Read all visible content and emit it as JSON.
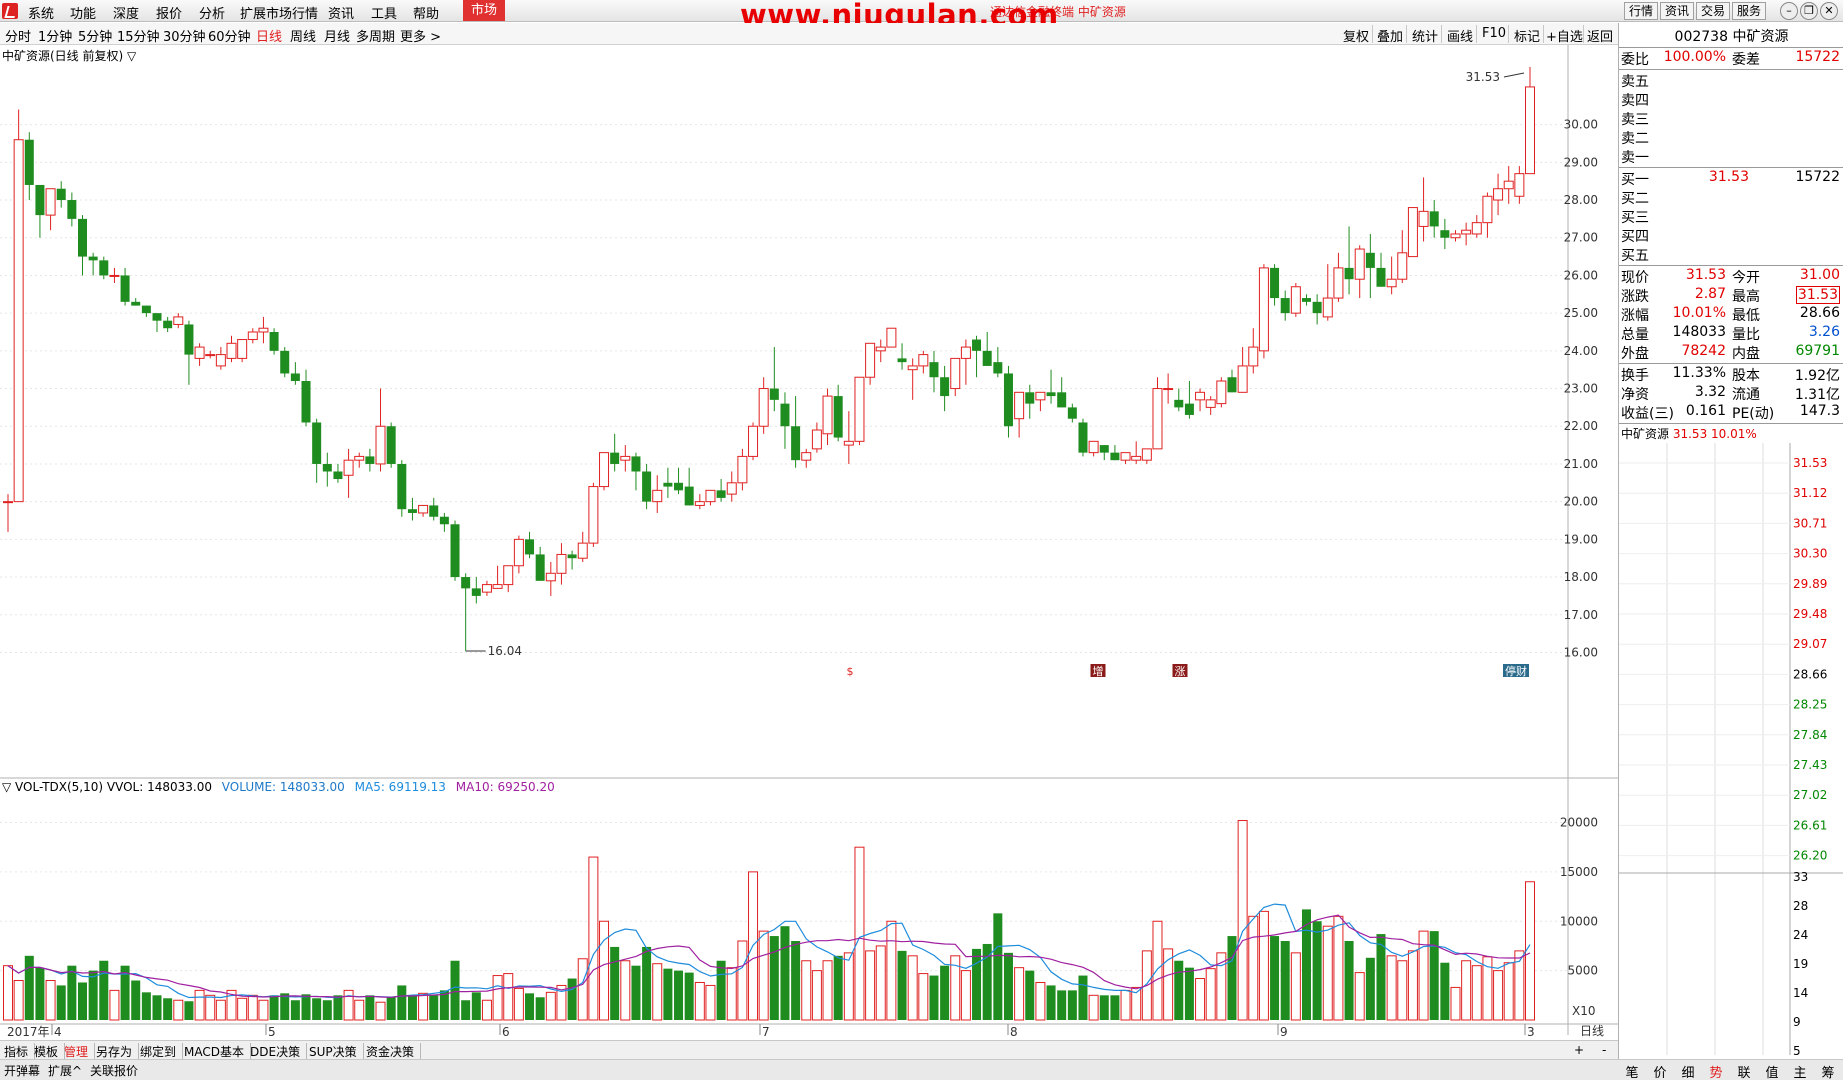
{
  "menu": {
    "items": [
      "系统",
      "功能",
      "深度",
      "报价",
      "分析",
      "扩展市场行情",
      "资讯",
      "工具",
      "帮助"
    ],
    "market": "市场",
    "banner": "通达信金融终端 中矿资源",
    "watermark": "www.niugulan.com",
    "right_buttons": [
      "行情",
      "资讯",
      "交易",
      "服务"
    ],
    "window_controls": [
      "minimize-icon",
      "restore-icon",
      "close-icon"
    ]
  },
  "periods": [
    "分时",
    "1分钟",
    "5分钟",
    "15分钟",
    "30分钟",
    "60分钟",
    "日线",
    "周线",
    "月线",
    "多周期",
    "更多 >"
  ],
  "active_period": "日线",
  "tools": [
    "复权",
    "叠加",
    "统计",
    "画线",
    "F10",
    "标记",
    "+自选",
    "返回"
  ],
  "kline": {
    "title": "中矿资源(日线 前复权) ▽",
    "max_label": "31.53",
    "min_label": "16.04",
    "price_ticks": [
      "30.00",
      "29.00",
      "28.00",
      "27.00",
      "26.00",
      "25.00",
      "24.00",
      "23.00",
      "22.00",
      "21.00",
      "20.00",
      "19.00",
      "18.00",
      "17.00",
      "16.00"
    ],
    "markers": [
      "$",
      "增",
      "涨",
      "停财"
    ]
  },
  "volume": {
    "header_name": "▽ VOL-TDX(5,10) VVOL: 148033.00",
    "header_volume": "VOLUME: 148033.00",
    "header_ma5": "MA5: 69119.13",
    "header_ma10": "MA10: 69250.20",
    "ticks": [
      "20000",
      "15000",
      "10000",
      "5000"
    ],
    "unit": "X10",
    "colors": {
      "volume": "#1e78c8",
      "ma5": "#1e8cdc",
      "ma10": "#a020a0"
    }
  },
  "date_axis": {
    "labels": [
      "2017年",
      "4",
      "5",
      "6",
      "7",
      "8",
      "9",
      "3"
    ],
    "right_label": "日线"
  },
  "chart_data": {
    "type": "candlestick",
    "ylim": [
      16,
      31.8
    ],
    "candles": [
      [
        20.0,
        20.2,
        19.2,
        20.0
      ],
      [
        20.0,
        30.4,
        28.3,
        29.6
      ],
      [
        29.6,
        29.8,
        28.0,
        28.4
      ],
      [
        28.4,
        28.2,
        27.0,
        27.6
      ],
      [
        27.6,
        28.3,
        27.2,
        28.3
      ],
      [
        28.3,
        28.5,
        27.8,
        28.0
      ],
      [
        28.0,
        28.2,
        27.3,
        27.5
      ],
      [
        27.5,
        27.6,
        26.0,
        26.5
      ],
      [
        26.5,
        26.6,
        26.0,
        26.4
      ],
      [
        26.4,
        26.5,
        25.9,
        26.0
      ],
      [
        26.0,
        26.2,
        25.8,
        26.0
      ],
      [
        26.0,
        26.2,
        25.2,
        25.3
      ],
      [
        25.3,
        25.4,
        25.2,
        25.2
      ],
      [
        25.2,
        25.2,
        24.9,
        25.0
      ],
      [
        25.0,
        25.0,
        24.5,
        24.8
      ],
      [
        24.8,
        24.9,
        24.5,
        24.6
      ],
      [
        24.7,
        25.0,
        24.6,
        24.9
      ],
      [
        24.7,
        24.8,
        23.1,
        23.9
      ],
      [
        23.8,
        24.2,
        23.6,
        24.1
      ],
      [
        23.9,
        24.0,
        23.8,
        23.9
      ],
      [
        23.6,
        24.1,
        23.5,
        23.9
      ],
      [
        23.8,
        24.4,
        23.7,
        24.2
      ],
      [
        23.8,
        24.3,
        23.7,
        24.3
      ],
      [
        24.3,
        24.6,
        24.2,
        24.5
      ],
      [
        24.5,
        24.9,
        24.2,
        24.6
      ],
      [
        24.5,
        24.6,
        23.9,
        24.0
      ],
      [
        24.0,
        24.1,
        23.3,
        23.4
      ],
      [
        23.4,
        23.7,
        23.1,
        23.2
      ],
      [
        23.2,
        23.5,
        22.0,
        22.1
      ],
      [
        22.1,
        22.2,
        20.5,
        21.0
      ],
      [
        21.0,
        21.3,
        20.4,
        20.8
      ],
      [
        20.8,
        21.0,
        20.5,
        20.6
      ],
      [
        20.7,
        21.4,
        20.1,
        21.1
      ],
      [
        21.1,
        21.3,
        20.9,
        21.2
      ],
      [
        21.2,
        21.4,
        20.8,
        21.0
      ],
      [
        21.0,
        23.0,
        20.8,
        22.0
      ],
      [
        22.0,
        22.1,
        20.9,
        21.0
      ],
      [
        21.0,
        21.1,
        19.6,
        19.8
      ],
      [
        19.8,
        20.1,
        19.5,
        19.7
      ],
      [
        19.7,
        19.9,
        19.6,
        19.9
      ],
      [
        19.9,
        20.1,
        19.5,
        19.6
      ],
      [
        19.6,
        19.7,
        19.2,
        19.4
      ],
      [
        19.4,
        19.5,
        17.9,
        18.0
      ],
      [
        18.0,
        18.1,
        16.04,
        17.7
      ],
      [
        17.7,
        18.0,
        17.3,
        17.5
      ],
      [
        17.6,
        17.9,
        17.5,
        17.8
      ],
      [
        17.7,
        18.3,
        17.7,
        17.8
      ],
      [
        17.8,
        18.2,
        17.6,
        18.3
      ],
      [
        18.3,
        19.1,
        18.1,
        19.0
      ],
      [
        19.0,
        19.2,
        18.5,
        18.6
      ],
      [
        18.6,
        18.8,
        17.9,
        17.9
      ],
      [
        17.9,
        18.4,
        17.5,
        18.1
      ],
      [
        18.1,
        18.9,
        17.8,
        18.6
      ],
      [
        18.6,
        18.7,
        18.2,
        18.5
      ],
      [
        18.5,
        19.2,
        18.4,
        18.9
      ],
      [
        18.9,
        20.5,
        18.8,
        20.4
      ],
      [
        20.4,
        21.3,
        20.3,
        21.3
      ],
      [
        21.3,
        21.8,
        20.8,
        21.0
      ],
      [
        21.1,
        21.5,
        20.8,
        21.2
      ],
      [
        21.2,
        21.3,
        20.3,
        20.8
      ],
      [
        20.8,
        21.0,
        19.8,
        20.0
      ],
      [
        20.0,
        20.7,
        19.7,
        20.3
      ],
      [
        20.5,
        20.9,
        20.1,
        20.4
      ],
      [
        20.5,
        20.9,
        20.2,
        20.3
      ],
      [
        20.4,
        20.9,
        19.9,
        19.9
      ],
      [
        19.9,
        20.2,
        19.8,
        20.0
      ],
      [
        20.0,
        20.3,
        19.9,
        20.3
      ],
      [
        20.3,
        20.6,
        20.0,
        20.1
      ],
      [
        20.2,
        20.8,
        20.0,
        20.5
      ],
      [
        20.5,
        21.4,
        20.3,
        21.2
      ],
      [
        21.2,
        22.1,
        21.1,
        22.0
      ],
      [
        22.0,
        23.3,
        21.8,
        23.0
      ],
      [
        23.0,
        24.1,
        22.4,
        22.7
      ],
      [
        22.6,
        22.9,
        21.4,
        22.0
      ],
      [
        22.0,
        22.8,
        20.9,
        21.1
      ],
      [
        21.1,
        21.4,
        20.9,
        21.3
      ],
      [
        21.4,
        22.1,
        21.3,
        21.9
      ],
      [
        21.8,
        23.0,
        21.5,
        22.8
      ],
      [
        22.8,
        23.1,
        21.6,
        21.7
      ],
      [
        21.5,
        22.4,
        21.0,
        21.6
      ],
      [
        21.6,
        23.3,
        21.5,
        23.3
      ],
      [
        23.3,
        24.1,
        23.1,
        24.2
      ],
      [
        24.0,
        24.3,
        23.7,
        24.1
      ],
      [
        24.1,
        24.6,
        24.2,
        24.6
      ],
      [
        23.8,
        24.2,
        23.5,
        23.7
      ],
      [
        23.5,
        23.8,
        22.7,
        23.6
      ],
      [
        23.6,
        24.0,
        23.4,
        23.9
      ],
      [
        23.7,
        24.0,
        22.9,
        23.3
      ],
      [
        23.3,
        23.6,
        22.4,
        22.8
      ],
      [
        23.0,
        23.8,
        22.8,
        23.8
      ],
      [
        23.8,
        24.3,
        23.1,
        24.1
      ],
      [
        24.3,
        24.4,
        23.3,
        24.0
      ],
      [
        24.0,
        24.5,
        23.8,
        23.6
      ],
      [
        23.7,
        24.1,
        23.3,
        23.4
      ],
      [
        23.4,
        23.6,
        21.7,
        22.0
      ],
      [
        22.2,
        22.4,
        21.7,
        22.9
      ],
      [
        22.9,
        23.1,
        22.2,
        22.6
      ],
      [
        22.7,
        22.9,
        22.4,
        22.9
      ],
      [
        22.9,
        23.5,
        22.6,
        22.8
      ],
      [
        22.9,
        23.3,
        22.7,
        22.5
      ],
      [
        22.5,
        22.6,
        22.1,
        22.2
      ],
      [
        22.1,
        22.2,
        21.2,
        21.3
      ],
      [
        21.3,
        21.4,
        21.2,
        21.6
      ],
      [
        21.5,
        21.5,
        21.1,
        21.3
      ],
      [
        21.3,
        21.5,
        21.1,
        21.1
      ],
      [
        21.1,
        21.3,
        21.0,
        21.3
      ],
      [
        21.1,
        21.6,
        21.0,
        21.2
      ],
      [
        21.1,
        21.4,
        21.0,
        21.4
      ],
      [
        21.4,
        23.3,
        21.4,
        23.0
      ],
      [
        23.0,
        23.4,
        22.6,
        23.0
      ],
      [
        22.7,
        23.0,
        22.4,
        22.5
      ],
      [
        22.6,
        23.2,
        22.2,
        22.3
      ],
      [
        22.7,
        23.0,
        22.4,
        22.9
      ],
      [
        22.5,
        22.8,
        22.3,
        22.7
      ],
      [
        22.6,
        23.3,
        22.5,
        23.2
      ],
      [
        23.3,
        23.5,
        23.0,
        22.9
      ],
      [
        22.9,
        24.1,
        22.9,
        23.6
      ],
      [
        23.6,
        24.6,
        23.4,
        24.1
      ],
      [
        24.0,
        26.3,
        23.8,
        26.2
      ],
      [
        26.2,
        26.3,
        25.2,
        25.4
      ],
      [
        25.4,
        25.6,
        24.8,
        25.0
      ],
      [
        25.0,
        25.8,
        24.9,
        25.7
      ],
      [
        25.4,
        25.5,
        25.2,
        25.3
      ],
      [
        25.3,
        25.5,
        24.7,
        25.0
      ],
      [
        24.9,
        26.3,
        24.8,
        25.4
      ],
      [
        25.4,
        26.6,
        25.3,
        26.2
      ],
      [
        26.2,
        27.3,
        25.5,
        25.9
      ],
      [
        25.9,
        26.8,
        25.4,
        26.7
      ],
      [
        26.6,
        27.1,
        25.4,
        26.2
      ],
      [
        26.2,
        26.6,
        25.7,
        25.7
      ],
      [
        25.7,
        26.5,
        25.5,
        25.9
      ],
      [
        25.9,
        27.2,
        25.8,
        26.6
      ],
      [
        26.5,
        27.5,
        27.1,
        27.8
      ],
      [
        27.3,
        28.6,
        26.9,
        27.7
      ],
      [
        27.7,
        28.0,
        27.0,
        27.3
      ],
      [
        27.2,
        27.5,
        26.7,
        27.0
      ],
      [
        27.0,
        27.2,
        26.9,
        27.1
      ],
      [
        27.1,
        27.4,
        26.8,
        27.2
      ],
      [
        27.1,
        27.6,
        27.0,
        27.4
      ],
      [
        27.4,
        28.2,
        27.0,
        28.1
      ],
      [
        28.0,
        28.7,
        27.6,
        28.3
      ],
      [
        28.3,
        28.9,
        27.9,
        28.5
      ],
      [
        28.1,
        28.9,
        27.9,
        28.7
      ],
      [
        28.7,
        31.53,
        28.8,
        31.0
      ]
    ],
    "volumes": [
      5500,
      4000,
      6500,
      5300,
      4000,
      3500,
      5500,
      3800,
      5000,
      6000,
      3000,
      5500,
      4000,
      2800,
      2500,
      2200,
      2000,
      1900,
      3000,
      2500,
      2000,
      3000,
      2200,
      2500,
      2000,
      2500,
      2700,
      2000,
      2600,
      2200,
      2000,
      2500,
      3000,
      2000,
      2500,
      1800,
      2300,
      3500,
      2500,
      2700,
      2500,
      3000,
      6000,
      2000,
      2800,
      2000,
      4500,
      4700,
      3200,
      2700,
      2300,
      2800,
      3500,
      4200,
      6200,
      16500,
      10000,
      7400,
      6000,
      5500,
      7400,
      5700,
      5200,
      5000,
      4800,
      3800,
      3500,
      6000,
      5300,
      8000,
      15000,
      9000,
      8500,
      9500,
      8000,
      6000,
      5000,
      6000,
      6500,
      6800,
      17500,
      7000,
      7500,
      10000,
      7000,
      6500,
      4700,
      4500,
      5500,
      6500,
      5000,
      7200,
      7700,
      10800,
      6800,
      5300,
      5000,
      3800,
      3500,
      3000,
      3000,
      4500,
      2500,
      2500,
      2500,
      3000,
      3300,
      7000,
      10000,
      7200,
      6000,
      5300,
      4200,
      5200,
      6800,
      8500,
      20200,
      10500,
      11000,
      8500,
      8000,
      6800,
      11200,
      10000,
      9500,
      10500,
      8000,
      4800,
      6300,
      8700,
      6500,
      6000,
      7000,
      9000,
      9000,
      5800,
      3300,
      6000,
      5500,
      6400,
      5000,
      5800,
      7000,
      14000
    ]
  },
  "right_panel": {
    "code": "002738",
    "name": "中矿资源",
    "weibi_label": "委比",
    "weibi_value": "100.00%",
    "weicha_label": "委差",
    "weicha_value": "15722",
    "sell": [
      "卖五",
      "卖四",
      "卖三",
      "卖二",
      "卖一"
    ],
    "buy": [
      {
        "label": "买一",
        "price": "31.53",
        "vol": "15722"
      },
      {
        "label": "买二",
        "price": "",
        "vol": ""
      },
      {
        "label": "买三",
        "price": "",
        "vol": ""
      },
      {
        "label": "买四",
        "price": "",
        "vol": ""
      },
      {
        "label": "买五",
        "price": "",
        "vol": ""
      }
    ],
    "quote_rows": [
      {
        "l1": "现价",
        "v1": "31.53",
        "l2": "今开",
        "v2": "31.00"
      },
      {
        "l1": "涨跌",
        "v1": "2.87",
        "l2": "最高",
        "v2": "31.53"
      },
      {
        "l1": "涨幅",
        "v1": "10.01%",
        "l2": "最低",
        "v2": "28.66"
      },
      {
        "l1": "总量",
        "v1": "148033",
        "l2": "量比",
        "v2": "3.26"
      },
      {
        "l1": "外盘",
        "v1": "78242",
        "l2": "内盘",
        "v2": "69791"
      }
    ],
    "fund_rows": [
      {
        "l1": "换手",
        "v1": "11.33%",
        "l2": "股本",
        "v2": "1.92亿"
      },
      {
        "l1": "净资",
        "v1": "3.32",
        "l2": "流通",
        "v2": "1.31亿"
      },
      {
        "l1": "收益(三)",
        "v1": "0.161",
        "l2": "PE(动)",
        "v2": "147.3"
      }
    ],
    "mini_title": "中矿资源",
    "mini_price": "31.53",
    "mini_pct": "10.01%",
    "mini_price_ticks": [
      "31.53",
      "31.12",
      "30.71",
      "30.30",
      "29.89",
      "29.48",
      "29.07",
      "28.66",
      "28.25",
      "27.84",
      "27.43",
      "27.02",
      "26.61",
      "26.20"
    ],
    "mini_vol_ticks": [
      "33",
      "28",
      "24",
      "19",
      "14",
      "9",
      "5"
    ]
  },
  "bottom_tabs": [
    "指标",
    "模板",
    "管理",
    "另存为",
    "绑定到",
    "MACD基本",
    "DDE决策",
    "SUP决策",
    "资金决策"
  ],
  "active_bottom_tab": "管理",
  "status_left": [
    "开弹幕",
    "扩展^",
    "关联报价"
  ],
  "status_right": [
    "笔",
    "价",
    "细",
    "势",
    "联",
    "值",
    "主",
    "筹"
  ],
  "active_status_right": "势",
  "plus_minus": [
    "+",
    "-"
  ]
}
